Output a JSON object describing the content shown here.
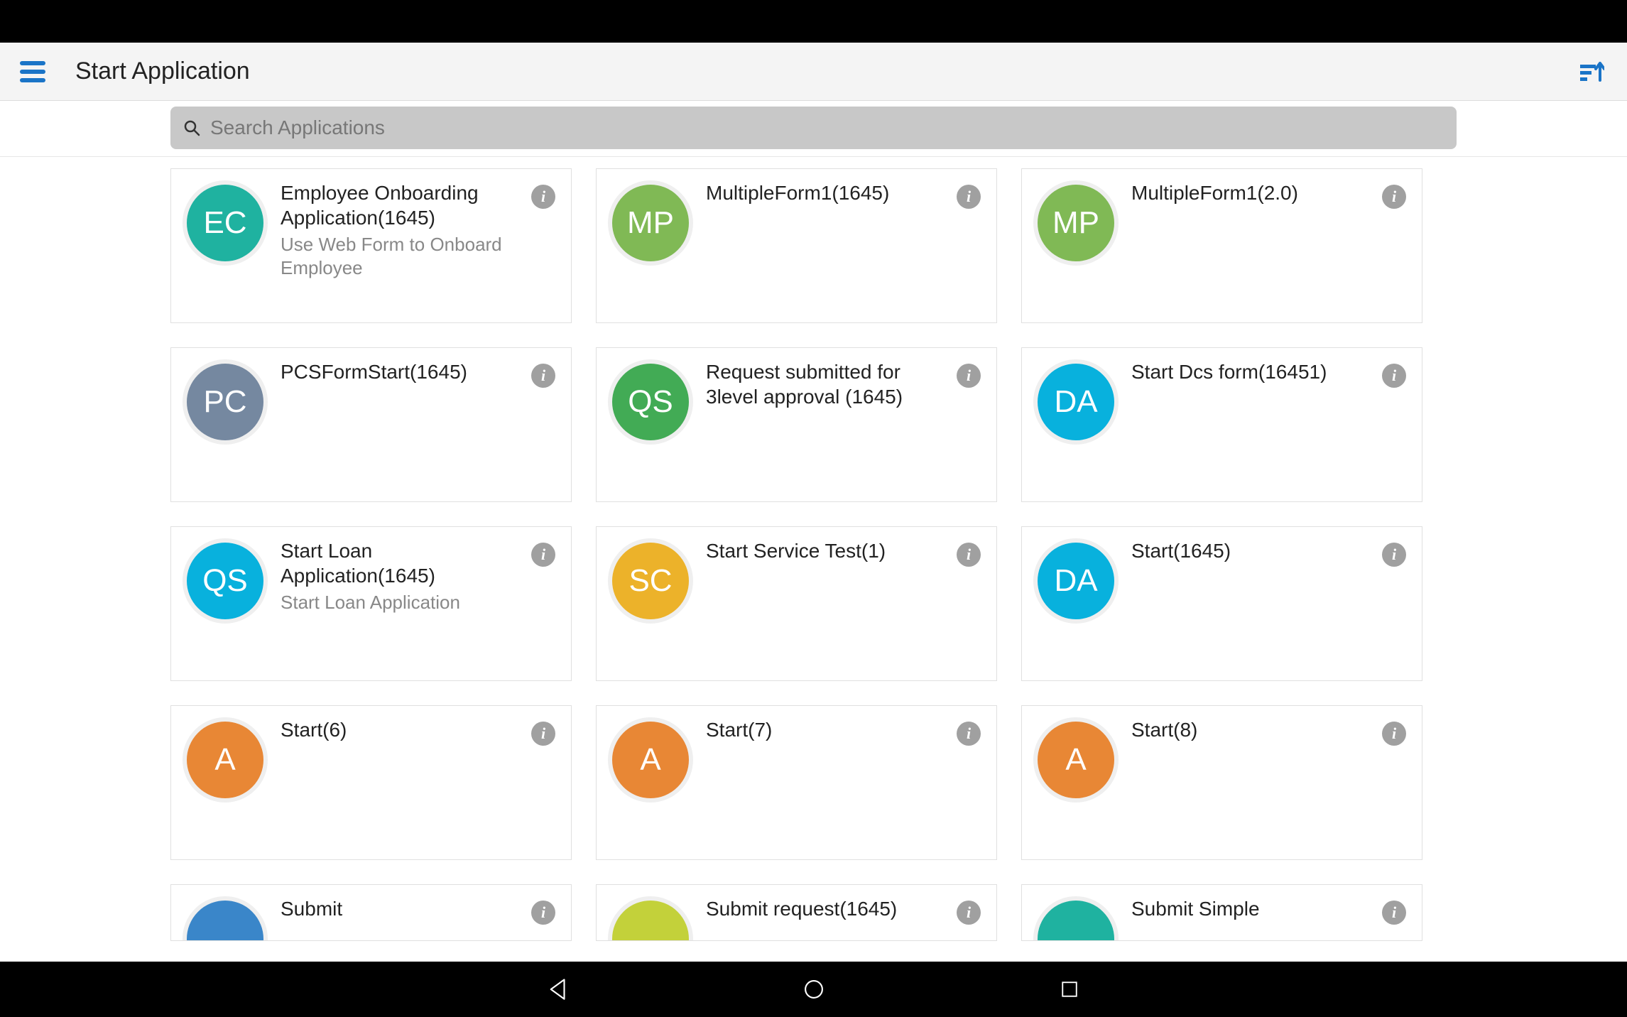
{
  "header": {
    "title": "Start Application"
  },
  "search": {
    "placeholder": "Search Applications"
  },
  "cards": [
    {
      "initials": "EC",
      "color": "#1fb2a0",
      "title": "Employee Onboarding Application(1645)",
      "subtitle": "Use Web Form to Onboard Employee"
    },
    {
      "initials": "MP",
      "color": "#80b955",
      "title": "MultipleForm1(1645)",
      "subtitle": ""
    },
    {
      "initials": "MP",
      "color": "#80b955",
      "title": "MultipleForm1(2.0)",
      "subtitle": ""
    },
    {
      "initials": "PC",
      "color": "#7588a0",
      "title": "PCSFormStart(1645)",
      "subtitle": ""
    },
    {
      "initials": "QS",
      "color": "#42ab55",
      "title": "Request submitted for 3level approval (1645)",
      "subtitle": ""
    },
    {
      "initials": "DA",
      "color": "#08b1dd",
      "title": "Start Dcs form(16451)",
      "subtitle": ""
    },
    {
      "initials": "QS",
      "color": "#08b1dd",
      "title": "Start Loan Application(1645)",
      "subtitle": "Start Loan Application"
    },
    {
      "initials": "SC",
      "color": "#ecb22a",
      "title": "Start Service Test(1)",
      "subtitle": ""
    },
    {
      "initials": "DA",
      "color": "#08b1dd",
      "title": "Start(1645)",
      "subtitle": ""
    },
    {
      "initials": "A",
      "color": "#e88735",
      "title": "Start(6)",
      "subtitle": ""
    },
    {
      "initials": "A",
      "color": "#e88735",
      "title": "Start(7)",
      "subtitle": ""
    },
    {
      "initials": "A",
      "color": "#e88735",
      "title": "Start(8)",
      "subtitle": ""
    },
    {
      "initials": "",
      "color": "#3a86c9",
      "title": "Submit",
      "subtitle": ""
    },
    {
      "initials": "",
      "color": "#c3d13a",
      "title": "Submit request(1645)",
      "subtitle": ""
    },
    {
      "initials": "",
      "color": "#1fb2a0",
      "title": "Submit Simple",
      "subtitle": ""
    }
  ]
}
